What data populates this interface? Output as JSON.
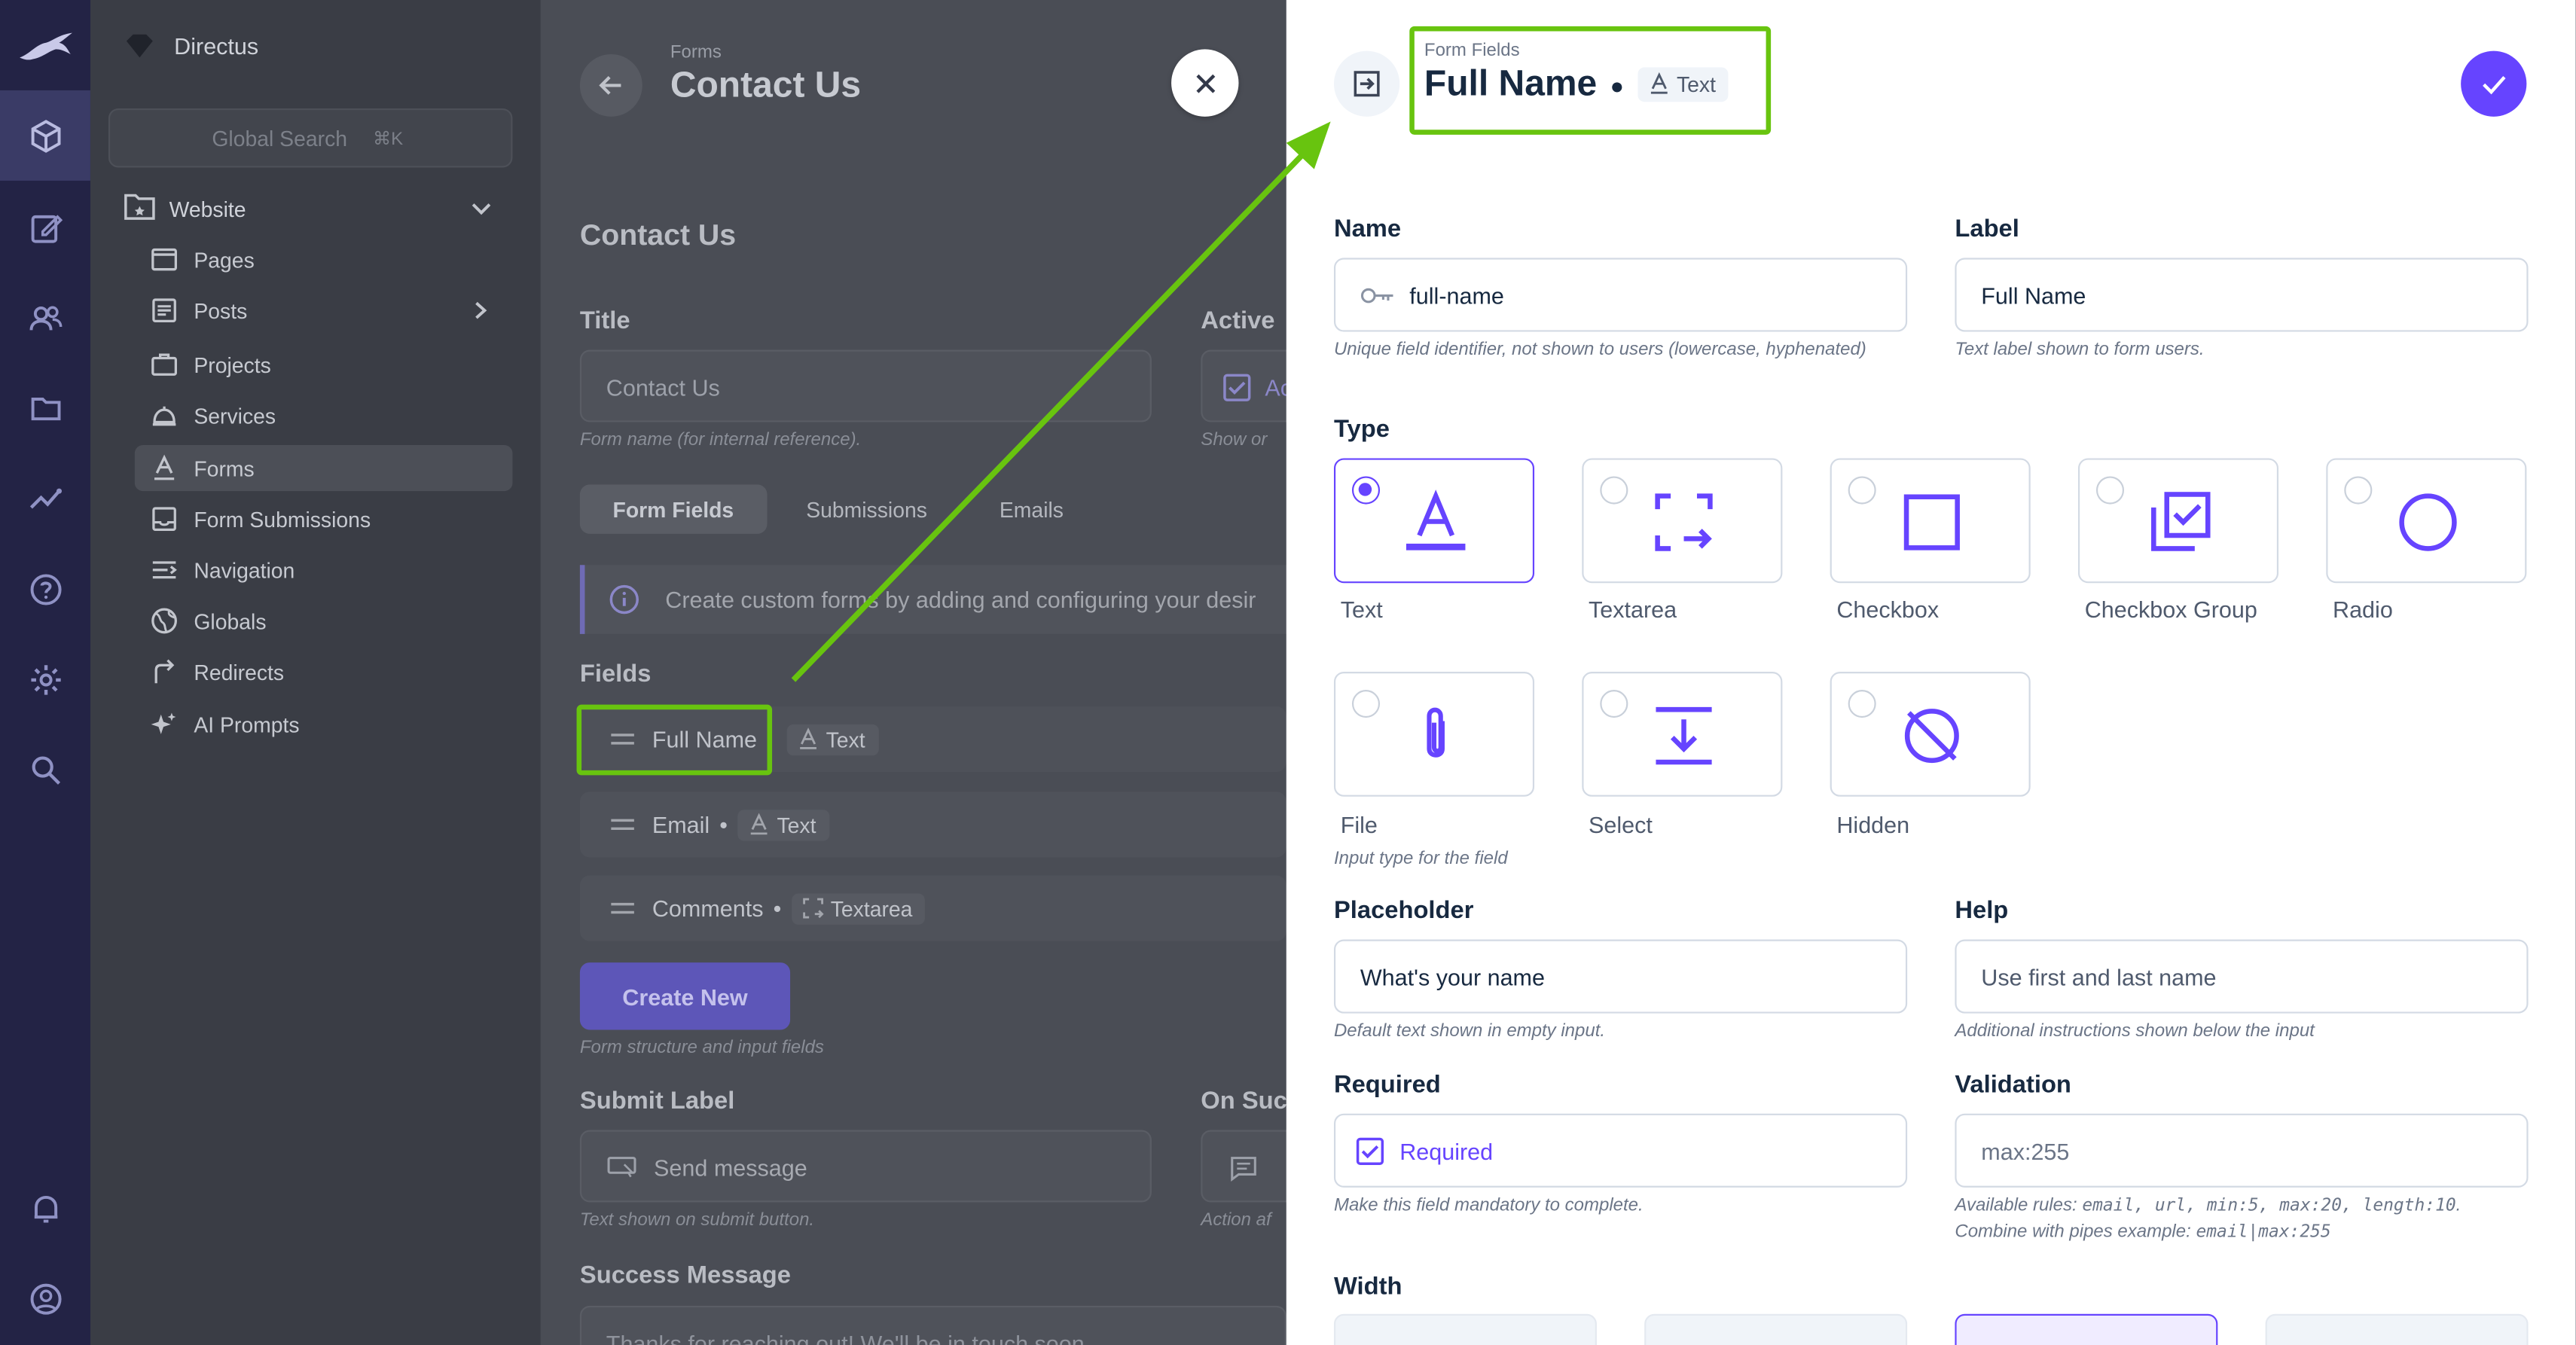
{
  "app": {
    "name": "Directus",
    "search_placeholder": "Global Search",
    "search_shortcut": "⌘K"
  },
  "nav": {
    "group_label": "Website",
    "items": [
      {
        "label": "Pages",
        "icon": "page-icon"
      },
      {
        "label": "Posts",
        "icon": "article-icon"
      },
      {
        "label": "Projects",
        "icon": "briefcase-icon"
      },
      {
        "label": "Services",
        "icon": "room-service-icon"
      },
      {
        "label": "Forms",
        "icon": "text-format-icon"
      },
      {
        "label": "Form Submissions",
        "icon": "inbox-icon"
      },
      {
        "label": "Navigation",
        "icon": "menu-icon"
      },
      {
        "label": "Globals",
        "icon": "globe-icon"
      },
      {
        "label": "Redirects",
        "icon": "redirect-icon"
      },
      {
        "label": "AI Prompts",
        "icon": "sparkle-icon"
      }
    ]
  },
  "content": {
    "breadcrumb": "Forms",
    "title": "Contact Us",
    "section_title": "Contact Us",
    "title_label": "Title",
    "title_value": "Contact Us",
    "title_hint": "Form name (for internal reference).",
    "active_label": "Active",
    "active_value": "Ac",
    "active_hint": "Show or",
    "tabs": [
      "Form Fields",
      "Submissions",
      "Emails"
    ],
    "notice": "Create custom forms by adding and configuring your desir",
    "fields_label": "Fields",
    "fields": [
      {
        "name": "Full Name",
        "type": "Text"
      },
      {
        "name": "Email",
        "type": "Text"
      },
      {
        "name": "Comments",
        "type": "Textarea"
      }
    ],
    "create_button": "Create New",
    "fields_hint": "Form structure and input fields",
    "submit_label": "Submit Label",
    "submit_value": "Send message",
    "submit_hint": "Text shown on submit button.",
    "on_success_label": "On Succ",
    "on_success_hint": "Action af",
    "success_message_label": "Success Message",
    "success_message_value": "Thanks for reaching out! We'll be in touch soon."
  },
  "drawer": {
    "breadcrumb": "Form Fields",
    "title": "Full Name",
    "title_type": "Text",
    "name_label": "Name",
    "name_value": "full-name",
    "name_hint": "Unique field identifier, not shown to users (lowercase, hyphenated)",
    "label_label": "Label",
    "label_value": "Full Name",
    "label_hint": "Text label shown to form users.",
    "type_label": "Type",
    "types": [
      {
        "label": "Text",
        "icon": "text-format-icon",
        "selected": true
      },
      {
        "label": "Textarea",
        "icon": "expand-arrow-icon",
        "selected": false
      },
      {
        "label": "Checkbox",
        "icon": "checkbox-icon",
        "selected": false
      },
      {
        "label": "Checkbox Group",
        "icon": "library-add-check-icon",
        "selected": false
      },
      {
        "label": "Radio",
        "icon": "radio-circle-icon",
        "selected": false
      },
      {
        "label": "File",
        "icon": "paperclip-icon",
        "selected": false
      },
      {
        "label": "Select",
        "icon": "download-arrow-icon",
        "selected": false
      },
      {
        "label": "Hidden",
        "icon": "hidden-icon",
        "selected": false
      }
    ],
    "type_hint": "Input type for the field",
    "placeholder_label": "Placeholder",
    "placeholder_value": "What's your name",
    "placeholder_hint": "Default text shown in empty input.",
    "help_label": "Help",
    "help_value": "Use first and last name",
    "help_hint": "Additional instructions shown below the input",
    "required_label": "Required",
    "required_value": "Required",
    "required_checked": true,
    "required_hint": "Make this field mandatory to complete.",
    "validation_label": "Validation",
    "validation_value": "max:255",
    "validation_hint_1a": "Available rules: ",
    "validation_hint_rules": "email, url, min:5, max:20, length:10",
    "validation_hint_1b": ".",
    "validation_hint_2a": "Combine with pipes example: ",
    "validation_hint_example": "email|max:255",
    "width_label": "Width"
  },
  "colors": {
    "accent": "#6644ff",
    "highlight": "#68c40f",
    "rail": "#232345"
  }
}
